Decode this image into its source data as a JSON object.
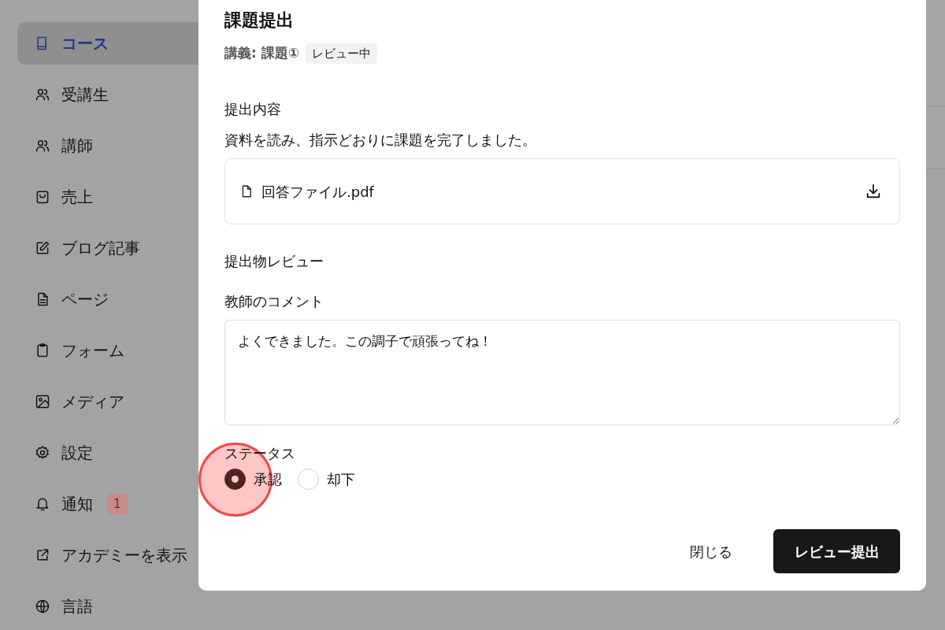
{
  "sidebar": {
    "items": [
      {
        "label": "コース",
        "selected": true
      },
      {
        "label": "受講生",
        "selected": false
      },
      {
        "label": "講師",
        "selected": false
      },
      {
        "label": "売上",
        "selected": false
      },
      {
        "label": "ブログ記事",
        "selected": false
      },
      {
        "label": "ページ",
        "selected": false
      },
      {
        "label": "フォーム",
        "selected": false
      },
      {
        "label": "メディア",
        "selected": false
      },
      {
        "label": "設定",
        "selected": false
      },
      {
        "label": "通知",
        "selected": false,
        "badge": "1"
      },
      {
        "label": "アカデミーを表示",
        "selected": false
      },
      {
        "label": "言語",
        "selected": false
      }
    ]
  },
  "dialog": {
    "title": "課題提出",
    "subtitle": "講義: 課題①",
    "status_badge": "レビュー中",
    "submission_heading": "提出内容",
    "submission_text": "資料を読み、指示どおりに課題を完了しました。",
    "attachment": {
      "filename": "回答ファイル.pdf"
    },
    "review_heading": "提出物レビュー",
    "comment_label": "教師のコメント",
    "comment_value": "よくできました。この調子で頑張ってね！",
    "status_label": "ステータス",
    "status_options": [
      {
        "label": "承認",
        "selected": true
      },
      {
        "label": "却下",
        "selected": false
      }
    ],
    "buttons": [
      {
        "label": "閉じる",
        "kind": "ghost"
      },
      {
        "label": "レビュー提出",
        "kind": "primary"
      }
    ]
  }
}
